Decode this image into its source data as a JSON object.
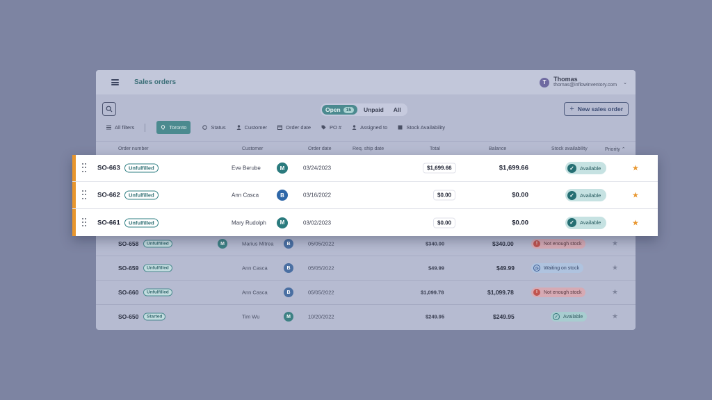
{
  "header": {
    "title": "Sales orders",
    "user_initial": "T",
    "user_name": "Thomas",
    "user_email": "thomas@inflowinventory.com"
  },
  "tabs": [
    {
      "label": "Open",
      "count": "15",
      "active": true
    },
    {
      "label": "Unpaid"
    },
    {
      "label": "All"
    }
  ],
  "new_button": "New sales order",
  "filters": {
    "all": "All filters",
    "location": "Toronto",
    "status": "Status",
    "customer": "Customer",
    "order_date": "Order date",
    "po": "PO #",
    "assigned": "Assigned to",
    "stock": "Stock Availability"
  },
  "columns": {
    "order_number": "Order number",
    "customer": "Customer",
    "order_date": "Order date",
    "req_ship_date": "Req. ship date",
    "total": "Total",
    "balance": "Balance",
    "stock": "Stock availability",
    "priority": "Priority"
  },
  "highlighted_rows": [
    {
      "order": "SO-663",
      "status": "Unfulfilled",
      "customer": "Eve Berube",
      "initial": "M",
      "date": "03/24/2023",
      "total": "$1,699.66",
      "balance": "$1,699.66",
      "stock": "Available"
    },
    {
      "order": "SO-662",
      "status": "Unfulfilled",
      "customer": "Ann Casca",
      "initial": "B",
      "date": "03/16/2022",
      "total": "$0.00",
      "balance": "$0.00",
      "stock": "Available"
    },
    {
      "order": "SO-661",
      "status": "Unfulfilled",
      "customer": "Mary Rudolph",
      "initial": "M",
      "date": "03/02/2023",
      "total": "$0.00",
      "balance": "$0.00",
      "stock": "Available"
    }
  ],
  "rows": [
    {
      "order": "SO-658",
      "status": "Unfulfilled",
      "initial_left": "M",
      "customer": "Marius Mitrea",
      "initial": "B",
      "date": "05/05/2022",
      "total": "$340.00",
      "balance": "$340.00",
      "stock": "Not enough stock"
    },
    {
      "order": "SO-659",
      "status": "Unfulfilled",
      "customer": "Ann Casca",
      "initial": "B",
      "date": "05/05/2022",
      "total": "$49.99",
      "balance": "$49.99",
      "stock": "Waiting on stock"
    },
    {
      "order": "SO-660",
      "status": "Unfulfilled",
      "customer": "Ann Casca",
      "initial": "B",
      "date": "05/05/2022",
      "total": "$1,099.78",
      "balance": "$1,099.78",
      "stock": "Not enough stock"
    },
    {
      "order": "SO-650",
      "status": "Started",
      "customer": "Tim Wu",
      "initial": "M",
      "date": "10/20/2022",
      "total": "$249.95",
      "balance": "$249.95",
      "stock": "Available"
    }
  ],
  "colors": {
    "accent": "#e8962e",
    "teal": "#4b8a8f",
    "background": "#7d84a2"
  }
}
